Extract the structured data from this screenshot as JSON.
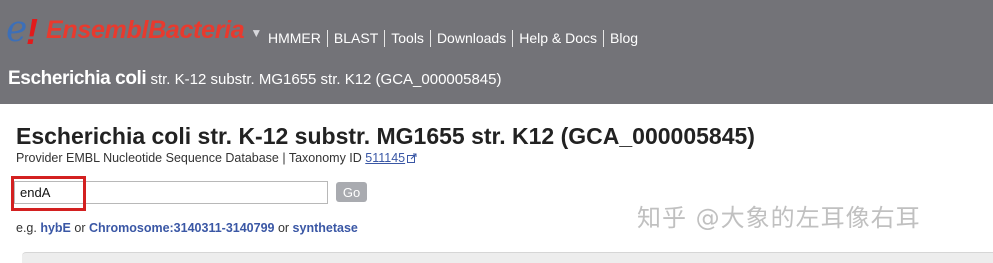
{
  "logo": {
    "e": "e",
    "bang": "!",
    "text": "EnsemblBacteria",
    "caret": "▼"
  },
  "nav": [
    "HMMER",
    "BLAST",
    "Tools",
    "Downloads",
    "Help & Docs",
    "Blog"
  ],
  "species_bar": {
    "bold": "Escherichia coli",
    "rest": " str. K-12 substr. MG1655 str. K12 (GCA_000005845)"
  },
  "main": {
    "title": "Escherichia coli str. K-12 substr. MG1655 str. K12 (GCA_000005845)",
    "provider_prefix": "Provider EMBL Nucleotide Sequence Database | Taxonomy ID ",
    "taxonomy_id": "511145"
  },
  "search": {
    "value": "endA",
    "button_label": "Go"
  },
  "examples": {
    "prefix": "e.g. ",
    "links": [
      "hybE",
      "Chromosome:3140311-3140799",
      "synthetase"
    ],
    "or": " or "
  },
  "watermark": "知乎 @大象的左耳像右耳",
  "colors": {
    "masthead": "#737378",
    "logo_red": "#e83a2e",
    "logo_blue": "#3c6fb8",
    "link": "#3a57a5",
    "highlight": "#d32020"
  }
}
